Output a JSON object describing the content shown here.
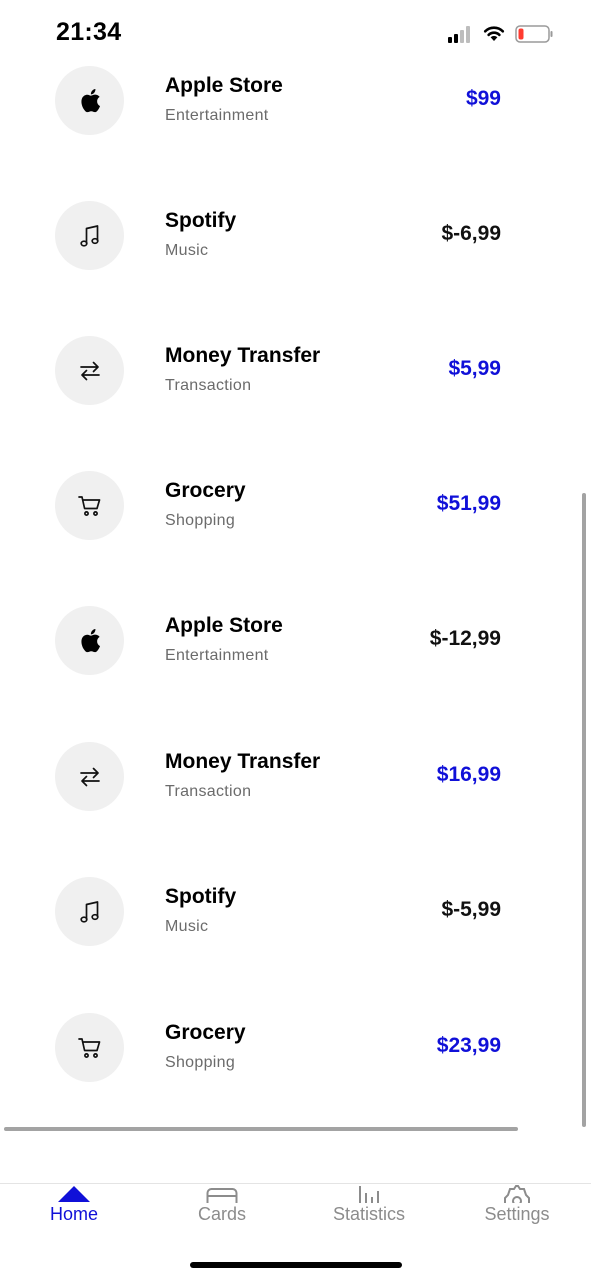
{
  "status_bar": {
    "time": "21:34",
    "battery_color": "#ff3b30"
  },
  "colors": {
    "accent": "#1010d8",
    "icon_background": "#f0f0f0",
    "muted_text": "#6b6b6b"
  },
  "transactions": [
    {
      "name": "Apple Store",
      "category": "Entertainment",
      "amount": "$99",
      "positive": true,
      "icon": "apple-icon"
    },
    {
      "name": "Spotify",
      "category": "Music",
      "amount": "$-6,99",
      "positive": false,
      "icon": "music-note-icon"
    },
    {
      "name": "Money Transfer",
      "category": "Transaction",
      "amount": "$5,99",
      "positive": true,
      "icon": "transfer-arrows-icon"
    },
    {
      "name": "Grocery",
      "category": "Shopping",
      "amount": "$51,99",
      "positive": true,
      "icon": "shopping-cart-icon"
    },
    {
      "name": "Apple Store",
      "category": "Entertainment",
      "amount": "$-12,99",
      "positive": false,
      "icon": "apple-icon"
    },
    {
      "name": "Money Transfer",
      "category": "Transaction",
      "amount": "$16,99",
      "positive": true,
      "icon": "transfer-arrows-icon"
    },
    {
      "name": "Spotify",
      "category": "Music",
      "amount": "$-5,99",
      "positive": false,
      "icon": "music-note-icon"
    },
    {
      "name": "Grocery",
      "category": "Shopping",
      "amount": "$23,99",
      "positive": true,
      "icon": "shopping-cart-icon"
    }
  ],
  "tab_bar": {
    "tabs": [
      {
        "label": "Home",
        "icon": "home-icon",
        "active": true
      },
      {
        "label": "Cards",
        "icon": "card-icon",
        "active": false
      },
      {
        "label": "Statistics",
        "icon": "statistics-icon",
        "active": false
      },
      {
        "label": "Settings",
        "icon": "gear-icon",
        "active": false
      }
    ]
  }
}
